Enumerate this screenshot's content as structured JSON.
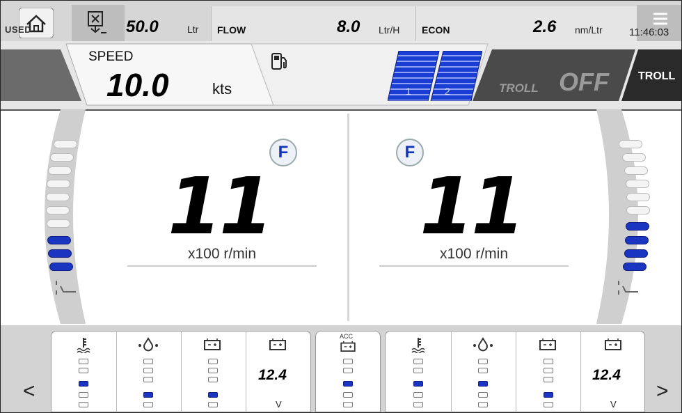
{
  "topbar": {
    "used_label": "USED",
    "fuel_used_value": "50.0",
    "fuel_used_unit": "Ltr",
    "flow_label": "FLOW",
    "flow_value": "8.0",
    "flow_unit": "Ltr/H",
    "econ_label": "ECON",
    "econ_value": "2.6",
    "econ_unit": "nm/Ltr",
    "time": "11:46:03",
    "icons": [
      "home-icon",
      "fuel-reset-icon",
      "menu-icon"
    ]
  },
  "speed_bar": {
    "speed_label": "SPEED",
    "speed_value": "10.0",
    "speed_unit": "kts",
    "tank_labels": [
      "1",
      "2"
    ],
    "troll_label": "TROLL",
    "troll_status": "OFF",
    "troll_button": "TROLL",
    "icons": [
      "fuel-pump-icon"
    ]
  },
  "engines": [
    {
      "gear": "F",
      "rpm": "11",
      "rpm_unit": "x100 r/min",
      "trim_level": 3,
      "trim_max": 10
    },
    {
      "gear": "F",
      "rpm": "11",
      "rpm_unit": "x100 r/min",
      "trim_level": 4,
      "trim_max": 10
    }
  ],
  "gauges": {
    "left": {
      "temp_level": 3,
      "oil_level": 4,
      "battery_level": 4,
      "voltage": "12.4",
      "volt_unit": "V"
    },
    "acc": {
      "label": "ACC",
      "level": 3
    },
    "right": {
      "temp_level": 3,
      "oil_level": 3,
      "battery_level": 4,
      "voltage": "12.4",
      "volt_unit": "V"
    },
    "segments": 5
  },
  "nav": {
    "prev": "<",
    "next": ">"
  },
  "colors": {
    "accent": "#1a35c0",
    "bar": "#d6d6d6"
  }
}
